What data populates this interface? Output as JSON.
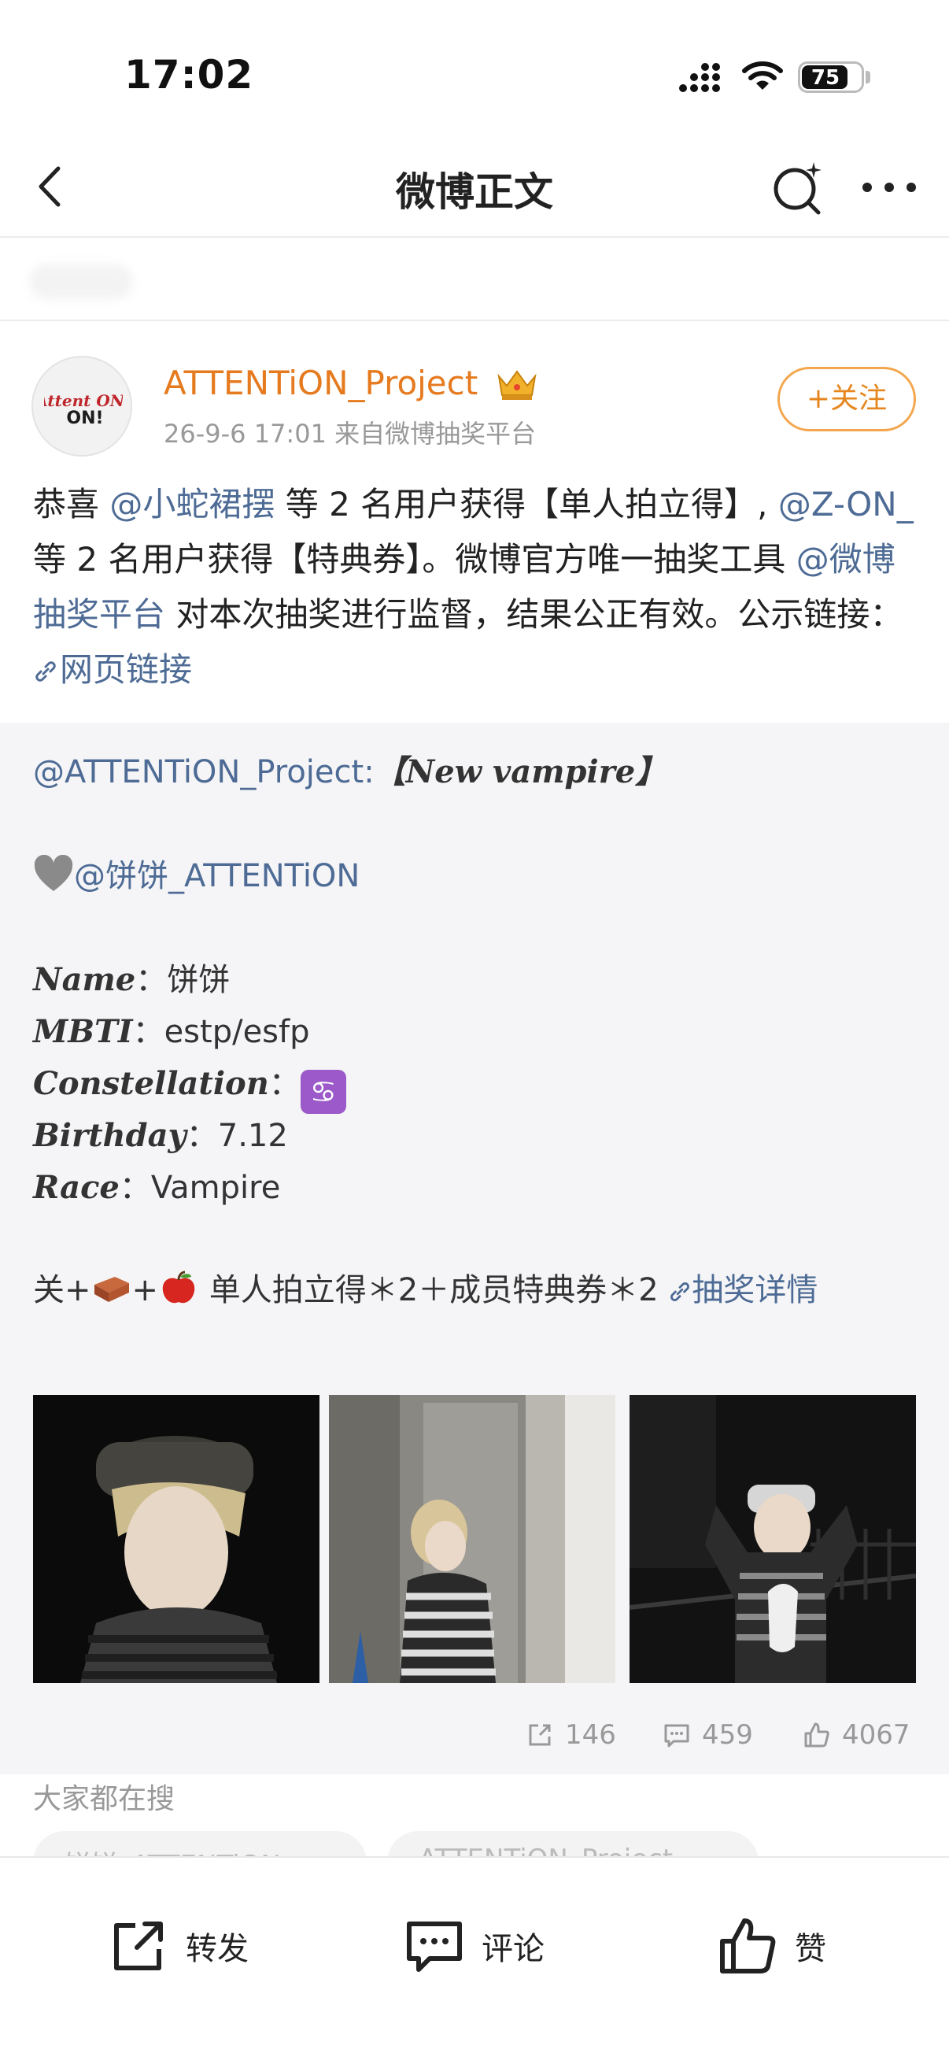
{
  "status_bar": {
    "time": "17:02",
    "battery": "75"
  },
  "nav": {
    "title": "微博正文"
  },
  "post": {
    "username": "ATTENTiON_Project",
    "avatar_text": "Attent ON!",
    "meta": "26-9-6 17:01  来自微博抽奖平台",
    "follow_label": "+关注",
    "text": {
      "p1": "恭喜 ",
      "mention1": "@小蛇裙摆",
      "p2": " 等 2 名用户获得【单人拍立得】, ",
      "mention2": "@Z-ON_",
      "p3": " 等 2 名用户获得【特典券】。微博官方唯一抽奖工具 ",
      "mention3": "@微博抽奖平台",
      "p4": " 对本次抽奖进行监督，结果公正有效。公示链接：",
      "link": "网页链接"
    }
  },
  "quote": {
    "author": "@ATTENTiON_Project:",
    "headline": "【New vampire】",
    "member_mention": "@饼饼_ATTENTiON",
    "fields": [
      {
        "label": "Name",
        "sep": "：",
        "value": "饼饼"
      },
      {
        "label": "MBTI",
        "sep": "：",
        "value": "estp/esfp"
      },
      {
        "label": "Constellation",
        "sep": "：",
        "value": "♋"
      },
      {
        "label": "Birthday",
        "sep": "：",
        "value": "7.12"
      },
      {
        "label": "Race",
        "sep": "：",
        "value": "Vampire"
      }
    ],
    "prize_a": "关+",
    "prize_b": "+",
    "prize_c": " 单人拍立得＊2＋成员特典券＊2 ",
    "prize_link": "抽奖详情",
    "stats": {
      "reposts": "146",
      "comments": "459",
      "likes": "4067"
    }
  },
  "trending": {
    "title": "大家都在搜",
    "pills": [
      "饼饼_ATTENTiON",
      "ATTENTiON_Project"
    ]
  },
  "actions": {
    "repost": "转发",
    "comment": "评论",
    "like": "赞"
  },
  "colors": {
    "accent": "#e57a1f",
    "link": "#4d6b95",
    "muted": "#999999"
  }
}
